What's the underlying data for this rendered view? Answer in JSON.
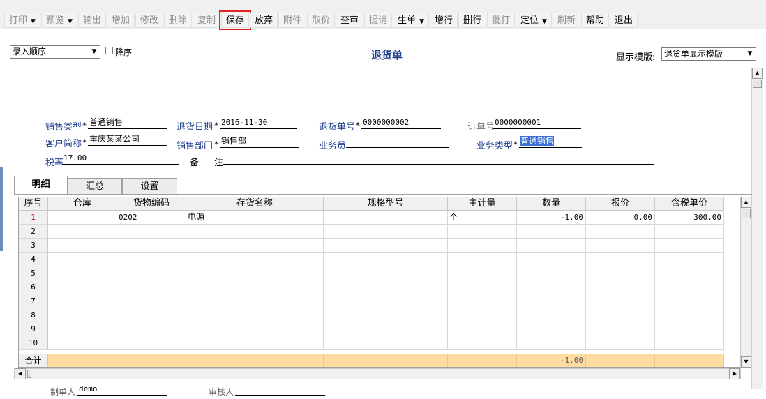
{
  "toolbar": [
    {
      "label": "打印",
      "enabled": false,
      "dropdown": true
    },
    {
      "label": "预览",
      "enabled": false,
      "dropdown": true
    },
    {
      "label": "输出",
      "enabled": false
    },
    {
      "label": "增加",
      "enabled": false
    },
    {
      "label": "修改",
      "enabled": false
    },
    {
      "label": "删除",
      "enabled": false
    },
    {
      "label": "复制",
      "enabled": false
    },
    {
      "label": "保存",
      "enabled": true,
      "highlighted": true
    },
    {
      "label": "放弃",
      "enabled": true
    },
    {
      "label": "附件",
      "enabled": false
    },
    {
      "label": "取价",
      "enabled": false
    },
    {
      "label": "查审",
      "enabled": true
    },
    {
      "label": "提请",
      "enabled": false
    },
    {
      "label": "生单",
      "enabled": true,
      "dropdown": true
    },
    {
      "label": "增行",
      "enabled": true
    },
    {
      "label": "删行",
      "enabled": true
    },
    {
      "label": "批打",
      "enabled": false
    },
    {
      "label": "定位",
      "enabled": true,
      "dropdown": true
    },
    {
      "label": "刷新",
      "enabled": false
    },
    {
      "label": "帮助",
      "enabled": true
    },
    {
      "label": "退出",
      "enabled": true
    }
  ],
  "header": {
    "order_select": "录入顺序",
    "desc_label": "降序",
    "title": "退货单",
    "template_label": "显示模版:",
    "template_value": "退货单显示模版"
  },
  "form": {
    "sales_type_label": "销售类型",
    "sales_type": "普通销售",
    "return_date_label": "退货日期",
    "return_date": "2016-11-30",
    "return_no_label": "退货单号",
    "return_no": "0000000002",
    "order_no_label": "订单号",
    "order_no": "0000000001",
    "customer_label": "客户简称",
    "customer": "重庆某某公司",
    "dept_label": "销售部门",
    "dept": "销售部",
    "salesman_label": "业务员",
    "salesman": "",
    "biz_type_label": "业务类型",
    "biz_type": "普通销售",
    "tax_rate_label": "税率",
    "tax_rate": "17.00",
    "remark_label_1": "备",
    "remark_label_2": "注",
    "remark": "",
    "required_mark": "*"
  },
  "tabs": [
    "明细",
    "汇总",
    "设置"
  ],
  "grid": {
    "columns": [
      "序号",
      "仓库",
      "货物编码",
      "存货名称",
      "规格型号",
      "主计量",
      "数量",
      "报价",
      "含税单价"
    ],
    "rows": [
      {
        "no": "1",
        "warehouse": "",
        "code": "0202",
        "name": "电源",
        "spec": "",
        "unit": "个",
        "qty": "-1.00",
        "quote": "0.00",
        "price": "300.00"
      },
      {
        "no": "2"
      },
      {
        "no": "3"
      },
      {
        "no": "4"
      },
      {
        "no": "5"
      },
      {
        "no": "6"
      },
      {
        "no": "7"
      },
      {
        "no": "8"
      },
      {
        "no": "9"
      },
      {
        "no": "10"
      }
    ],
    "total_label": "合计",
    "total_qty": "-1.00"
  },
  "footer": {
    "maker_label": "制单人",
    "maker": "demo",
    "reviewer_label": "审核人",
    "reviewer": ""
  },
  "colors": {
    "title": "#1f3f8f",
    "highlight_box": "#e02424",
    "total_row": "#ffdca0",
    "selection": "#3a6fd8"
  }
}
